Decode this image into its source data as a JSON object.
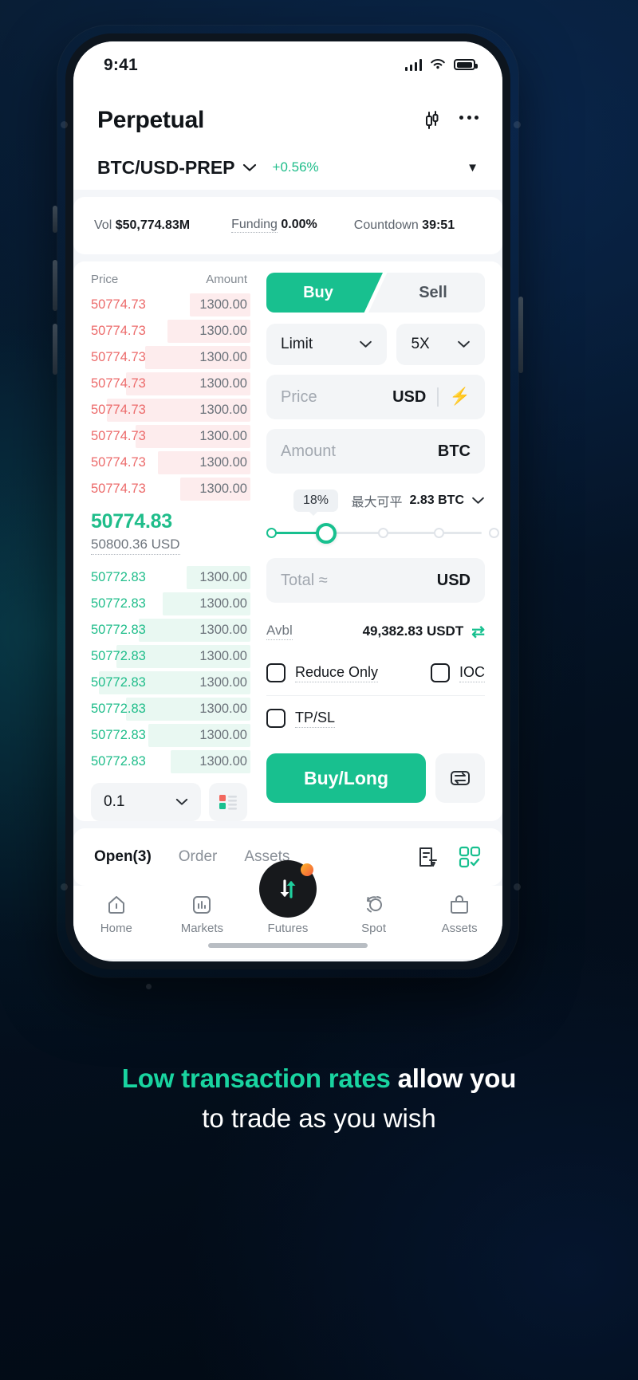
{
  "status_bar": {
    "time": "9:41",
    "signal_icon": "cellular-signal-icon",
    "wifi_icon": "wifi-icon",
    "battery_icon": "battery-full-icon"
  },
  "header": {
    "title": "Perpetual",
    "chart_icon": "candlestick-chart-icon",
    "more_icon": "more-options-icon",
    "pair": "BTC/USD-PREP",
    "pair_chevron": "chevron-down-icon",
    "change": "+0.56%",
    "change_color": "#1fbd8a",
    "expand_caret": "caret-down-icon"
  },
  "stats": {
    "vol_label": "Vol",
    "vol_value": "$50,774.83M",
    "funding_label": "Funding",
    "funding_value": "0.00%",
    "countdown_label": "Countdown",
    "countdown_value": "39:51"
  },
  "orderbook": {
    "col_price": "Price",
    "col_amount": "Amount",
    "asks": [
      {
        "price": "50774.73",
        "amount": "1300.00",
        "depth": 38
      },
      {
        "price": "50774.73",
        "amount": "1300.00",
        "depth": 52
      },
      {
        "price": "50774.73",
        "amount": "1300.00",
        "depth": 66
      },
      {
        "price": "50774.73",
        "amount": "1300.00",
        "depth": 78
      },
      {
        "price": "50774.73",
        "amount": "1300.00",
        "depth": 90
      },
      {
        "price": "50774.73",
        "amount": "1300.00",
        "depth": 72
      },
      {
        "price": "50774.73",
        "amount": "1300.00",
        "depth": 58
      },
      {
        "price": "50774.73",
        "amount": "1300.00",
        "depth": 44
      }
    ],
    "mid_price": "50774.83",
    "mid_price_usd": "50800.36 USD",
    "bids": [
      {
        "price": "50772.83",
        "amount": "1300.00",
        "depth": 40
      },
      {
        "price": "50772.83",
        "amount": "1300.00",
        "depth": 55
      },
      {
        "price": "50772.83",
        "amount": "1300.00",
        "depth": 70
      },
      {
        "price": "50772.83",
        "amount": "1300.00",
        "depth": 84
      },
      {
        "price": "50772.83",
        "amount": "1300.00",
        "depth": 95
      },
      {
        "price": "50772.83",
        "amount": "1300.00",
        "depth": 78
      },
      {
        "price": "50772.83",
        "amount": "1300.00",
        "depth": 64
      },
      {
        "price": "50772.83",
        "amount": "1300.00",
        "depth": 50
      }
    ],
    "tick_size": "0.1",
    "tick_chevron": "chevron-down-icon",
    "depth_view_icon": "orderbook-layout-icon"
  },
  "order_form": {
    "buy_label": "Buy",
    "sell_label": "Sell",
    "order_type": "Limit",
    "order_type_chevron": "chevron-down-icon",
    "leverage": "5X",
    "leverage_chevron": "chevron-down-icon",
    "price_placeholder": "Price",
    "price_unit": "USD",
    "price_bolt_icon": "lightning-bolt-icon",
    "amount_placeholder": "Amount",
    "amount_unit": "BTC",
    "percent_badge": "18%",
    "max_label": "最大可平",
    "max_value": "2.83 BTC",
    "max_chevron": "chevron-down-icon",
    "total_placeholder": "Total ≈",
    "total_unit": "USD",
    "avbl_label": "Avbl",
    "avbl_value": "49,382.83 USDT",
    "avbl_swap_icon": "swap-arrows-icon",
    "reduce_only": "Reduce Only",
    "ioc": "IOC",
    "tpsl": "TP/SL",
    "submit_label": "Buy/Long",
    "submit_color": "#18c08f",
    "submit_swap_icon": "switch-mode-icon"
  },
  "positions": {
    "tabs": [
      {
        "label": "Open(3)",
        "active": true
      },
      {
        "label": "Order",
        "active": false
      },
      {
        "label": "Assets",
        "active": false
      }
    ],
    "history_icon": "order-history-icon",
    "grid_icon": "grid-check-icon"
  },
  "bottom_nav": {
    "items": [
      {
        "label": "Home",
        "icon": "home-icon"
      },
      {
        "label": "Markets",
        "icon": "markets-bar-icon"
      },
      {
        "label": "Futures",
        "icon": "futures-swap-icon"
      },
      {
        "label": "Spot",
        "icon": "spot-circle-icon"
      },
      {
        "label": "Assets",
        "icon": "assets-bag-icon"
      }
    ]
  },
  "caption": {
    "highlight": "Low transaction rates",
    "rest": " allow you",
    "line2": "to trade as you wish",
    "highlight_color": "#19d4a0"
  }
}
